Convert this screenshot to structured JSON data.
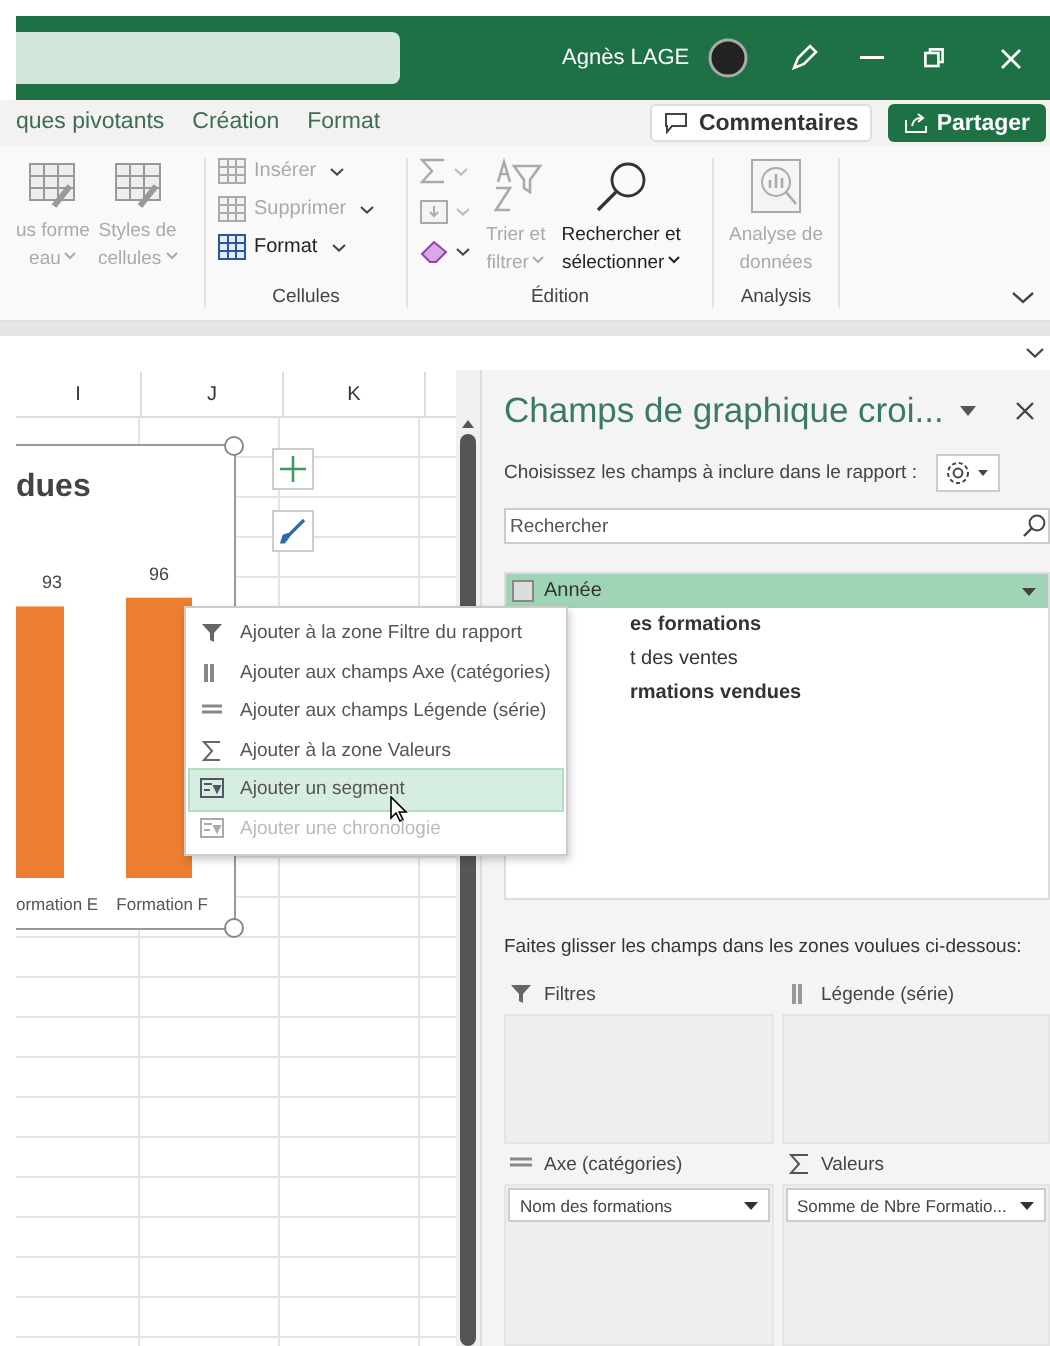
{
  "title_bar": {
    "user": "Agnès LAGE"
  },
  "tabs": [
    {
      "label": "ques pivotants",
      "selected": false
    },
    {
      "label": "Création",
      "selected": false
    },
    {
      "label": "Format",
      "selected": false
    }
  ],
  "comments_button": "Commentaires",
  "share_button": "Partager",
  "ribbon": {
    "styles_group": [
      {
        "lines": [
          "us forme",
          "eau"
        ],
        "disabled": true
      },
      {
        "lines": [
          "Styles de",
          "cellules"
        ],
        "disabled": true
      }
    ],
    "cells_group": {
      "label": "Cellules",
      "items": [
        {
          "label": "Insérer",
          "disabled": true
        },
        {
          "label": "Supprimer",
          "disabled": true
        },
        {
          "label": "Format",
          "disabled": false
        }
      ]
    },
    "editing_group": {
      "label": "Édition",
      "tools": [
        {
          "disabled": true
        },
        {
          "disabled": true
        },
        {
          "disabled": false
        }
      ],
      "items": [
        {
          "lines": [
            "Trier et",
            "filtrer"
          ],
          "disabled": true
        },
        {
          "lines": [
            "Rechercher et",
            "sélectionner"
          ],
          "disabled": false
        }
      ]
    },
    "analysis_group": {
      "label": "Analysis",
      "items": [
        {
          "lines": [
            "Analyse de",
            "données"
          ],
          "disabled": true
        }
      ]
    }
  },
  "sheet": {
    "columns": [
      "I",
      "J",
      "K"
    ]
  },
  "chart": {
    "chart_data": {
      "type": "bar",
      "title": "dues",
      "categories": [
        "ormation E",
        "Formation F"
      ],
      "values": [
        93,
        96
      ],
      "data_labels": true
    }
  },
  "context_menu": [
    {
      "label": "Ajouter à la zone Filtre du rapport",
      "selected": false,
      "disabled": false
    },
    {
      "label": "Ajouter aux champs Axe (catégories)",
      "selected": false,
      "disabled": false
    },
    {
      "label": "Ajouter aux champs Légende (série)",
      "selected": false,
      "disabled": false
    },
    {
      "label": "Ajouter à la zone Valeurs",
      "selected": false,
      "disabled": false
    },
    {
      "label": "Ajouter un segment",
      "selected": true,
      "disabled": false
    },
    {
      "label": "Ajouter une chronologie",
      "selected": false,
      "disabled": true
    }
  ],
  "field_pane": {
    "title": "Champs de graphique croi...",
    "subtitle": "Choisissez les champs à inclure dans le rapport :",
    "search_placeholder": "Rechercher",
    "fields": [
      {
        "label": "Année",
        "checked": false,
        "selected": true
      },
      {
        "label": "es formations",
        "checked": true,
        "selected": false
      },
      {
        "label": "t des ventes",
        "checked": false,
        "selected": false
      },
      {
        "label": "rmations vendues",
        "checked": true,
        "selected": false
      }
    ],
    "drag_hint": "Faites glisser les champs dans les zones voulues ci-dessous:",
    "areas": [
      {
        "label": "Filtres"
      },
      {
        "label": "Légende (série)"
      },
      {
        "label": "Axe (catégories)",
        "field": "Nom des formations"
      },
      {
        "label": "Valeurs",
        "field": "Somme de Nbre Formatio..."
      }
    ]
  }
}
